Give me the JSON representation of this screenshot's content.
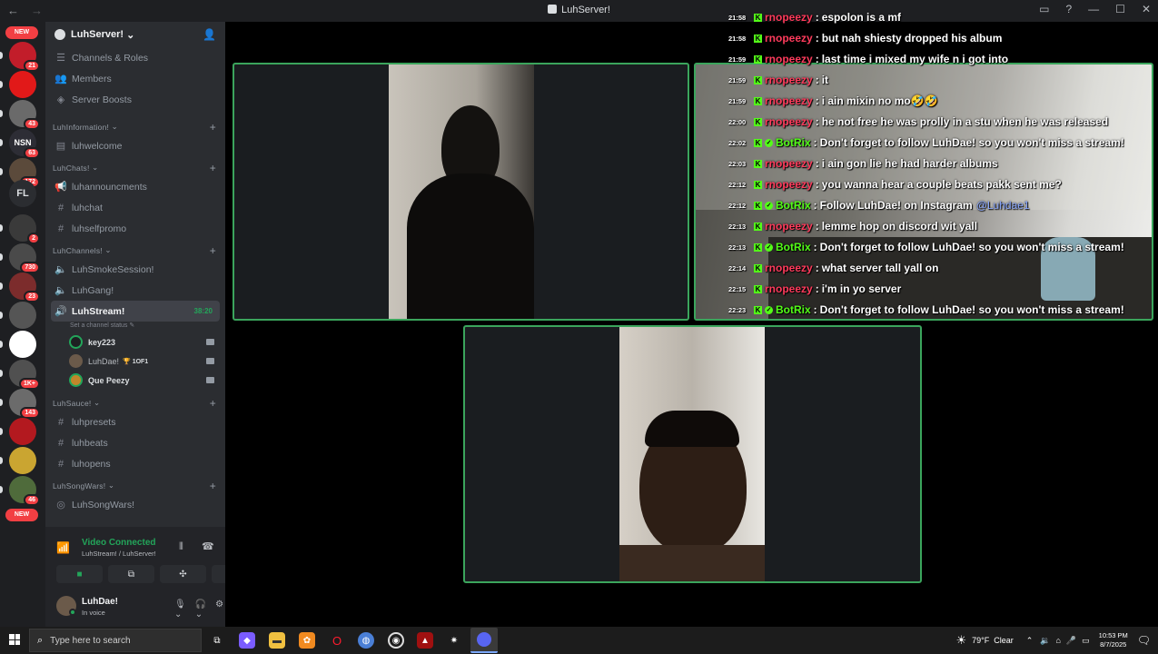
{
  "window": {
    "title": "LuhServer!"
  },
  "rail": {
    "new_label": "NEW",
    "fl_label": "FL",
    "servers": [
      {
        "badge": "21",
        "color": "#c21d2a"
      },
      {
        "badge": "",
        "color": "#e11919"
      },
      {
        "badge": "43",
        "color": "#6a6a6a"
      },
      {
        "badge": "63",
        "color": "#2d2d35",
        "text": "NSN"
      },
      {
        "badge": "172",
        "color": "#5b4a3b"
      },
      {
        "badge": "2",
        "color": "#3a3a3a"
      },
      {
        "badge": "730",
        "color": "#4a4a4a"
      },
      {
        "badge": "23",
        "color": "#7c2c2c"
      },
      {
        "badge": "",
        "color": "#555"
      },
      {
        "badge": "",
        "color": "#ffffff"
      },
      {
        "badge": "1K+",
        "color": "#505050"
      },
      {
        "badge": "143",
        "color": "#6b6b6b"
      },
      {
        "badge": "",
        "color": "#b3191f"
      },
      {
        "badge": "",
        "color": "#caa531"
      },
      {
        "badge": "46",
        "color": "#4f6b3b"
      }
    ]
  },
  "sidebar": {
    "server_name": "LuhServer!",
    "top_items": [
      "Channels & Roles",
      "Members",
      "Server Boosts"
    ],
    "cat1": "LuhInformation!",
    "welcome": "luhwelcome",
    "cat2": "LuhChats!",
    "chat1": "luhannouncments",
    "chat2": "luhchat",
    "chat3": "luhselfpromo",
    "cat3": "LuhChannels!",
    "vc1": "LuhSmokeSession!",
    "vc2": "LuhGang!",
    "vc3": "LuhStream!",
    "vc3_time": "38:20",
    "vc3_status": "Set a channel status",
    "voice_users": [
      {
        "name": "key223",
        "color": "#1e1f22"
      },
      {
        "name": "LuhDae!",
        "color": "#6b5a4a",
        "trophy": "🏆 1OF1"
      },
      {
        "name": "Que Peezy",
        "color": "#c2862b"
      }
    ],
    "cat4": "LuhSauce!",
    "sauce1": "luhpresets",
    "sauce2": "luhbeats",
    "sauce3": "luhopens",
    "cat5": "LuhSongWars!",
    "songwars": "LuhSongWars!"
  },
  "voice_panel": {
    "title": "Video Connected",
    "subtitle": "LuhStream! / LuhServer!"
  },
  "user": {
    "name": "LuhDae!",
    "status": "In voice"
  },
  "chat": [
    {
      "time": "21:58",
      "user": "rnopeezy",
      "color": "#ff3b5c",
      "text": "espolon is a mf",
      "bot": false
    },
    {
      "time": "21:58",
      "user": "rnopeezy",
      "color": "#ff3b5c",
      "text": "but nah shiesty dropped his album",
      "bot": false
    },
    {
      "time": "21:59",
      "user": "rnopeezy",
      "color": "#ff3b5c",
      "text": "last time i mixed my wife n i got into",
      "bot": false
    },
    {
      "time": "21:59",
      "user": "rnopeezy",
      "color": "#ff3b5c",
      "text": "it",
      "bot": false
    },
    {
      "time": "21:59",
      "user": "rnopeezy",
      "color": "#ff3b5c",
      "text": "i ain mixin no mo🤣🤣",
      "bot": false
    },
    {
      "time": "22:00",
      "user": "rnopeezy",
      "color": "#ff3b5c",
      "text": "he not free he was prolly in a stu when he was released",
      "bot": false
    },
    {
      "time": "22:02",
      "user": "BotRix",
      "color": "#53fc18",
      "text": "Don't forget to follow LuhDae! so you won't miss a stream!",
      "bot": true
    },
    {
      "time": "22:03",
      "user": "rnopeezy",
      "color": "#ff3b5c",
      "text": "i ain gon lie he had harder albums",
      "bot": false
    },
    {
      "time": "22:12",
      "user": "rnopeezy",
      "color": "#ff3b5c",
      "text": "you wanna hear a couple beats pakk sent me?",
      "bot": false
    },
    {
      "time": "22:12",
      "user": "BotRix",
      "color": "#53fc18",
      "text": "Follow LuhDae! on Instagram",
      "mention": "@Luhdae1",
      "bot": true
    },
    {
      "time": "22:13",
      "user": "rnopeezy",
      "color": "#ff3b5c",
      "text": "lemme hop on discord wit yall",
      "bot": false
    },
    {
      "time": "22:13",
      "user": "BotRix",
      "color": "#53fc18",
      "text": "Don't forget to follow LuhDae! so you won't miss a stream!",
      "bot": true
    },
    {
      "time": "22:14",
      "user": "rnopeezy",
      "color": "#ff3b5c",
      "text": "what server tall yall on",
      "bot": false
    },
    {
      "time": "22:15",
      "user": "rnopeezy",
      "color": "#ff3b5c",
      "text": "i'm in yo server",
      "bot": false
    },
    {
      "time": "22:23",
      "user": "BotRix",
      "color": "#53fc18",
      "text": "Don't forget to follow LuhDae! so you won't miss a stream!",
      "bot": true
    }
  ],
  "taskbar": {
    "search_placeholder": "Type here to search",
    "weather": "79°F  Clear",
    "time": "10:53 PM",
    "date": "8/7/2025"
  },
  "colors": {
    "accent_green": "#3ba55c",
    "voice_green": "#23a55a",
    "kick_green": "#53fc18",
    "user_red": "#ff3b5c"
  }
}
